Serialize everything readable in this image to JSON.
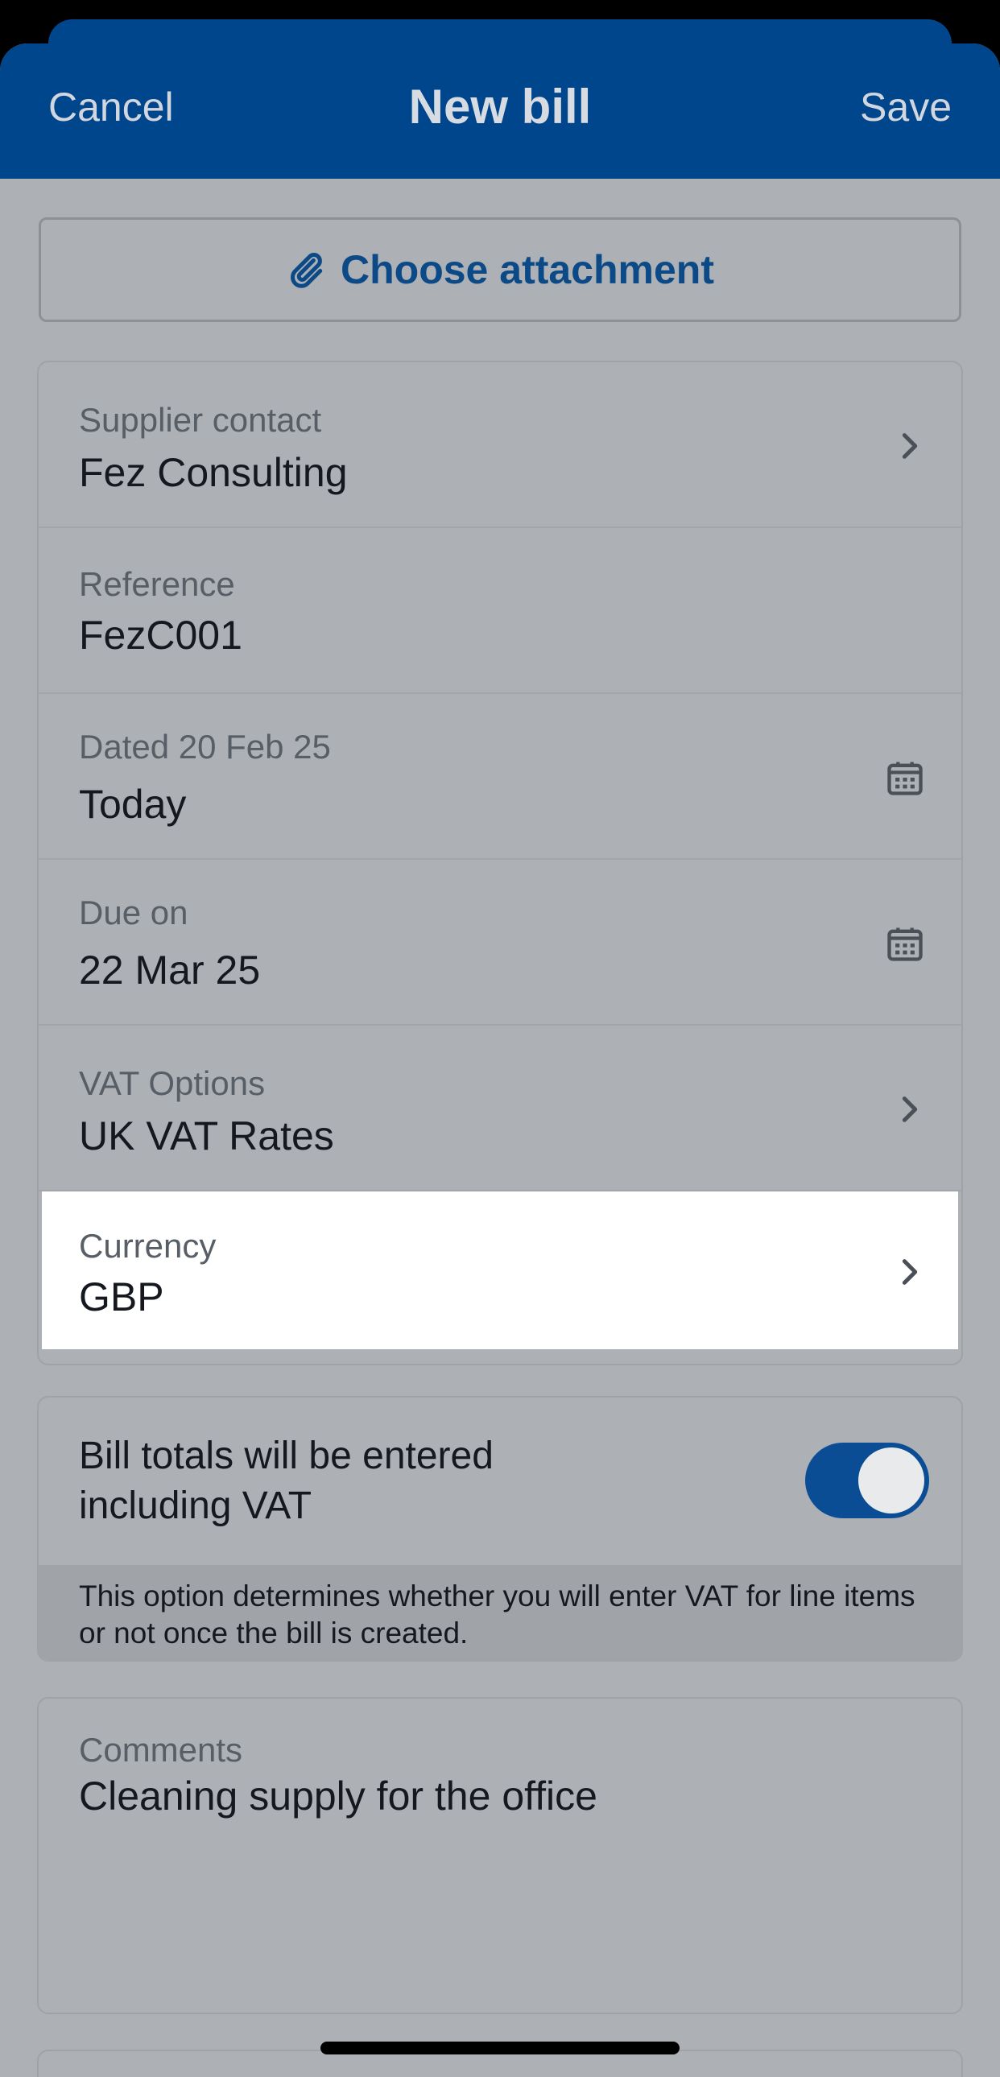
{
  "nav": {
    "cancel": "Cancel",
    "title": "New bill",
    "save": "Save"
  },
  "attachment": {
    "label": "Choose attachment",
    "icon": "paperclip-icon"
  },
  "fields": {
    "supplier": {
      "label": "Supplier contact",
      "value": "Fez Consulting"
    },
    "reference": {
      "label": "Reference",
      "value": "FezC001"
    },
    "dated": {
      "label": "Dated 20 Feb 25",
      "value": "Today"
    },
    "due": {
      "label": "Due on",
      "value": "22 Mar 25"
    },
    "vat_options": {
      "label": "VAT Options",
      "value": "UK VAT Rates"
    },
    "currency": {
      "label": "Currency",
      "value": "GBP"
    }
  },
  "vat_toggle": {
    "label": "Bill totals will be entered including VAT",
    "enabled": true,
    "note": "This option determines whether you will enter VAT for line items or not once the bill is created."
  },
  "comments": {
    "label": "Comments",
    "value": "Cleaning supply for the office"
  },
  "colors": {
    "brand": "#00468c",
    "highlight_row": "#ffffff",
    "dim_background": "#adb0b5"
  }
}
